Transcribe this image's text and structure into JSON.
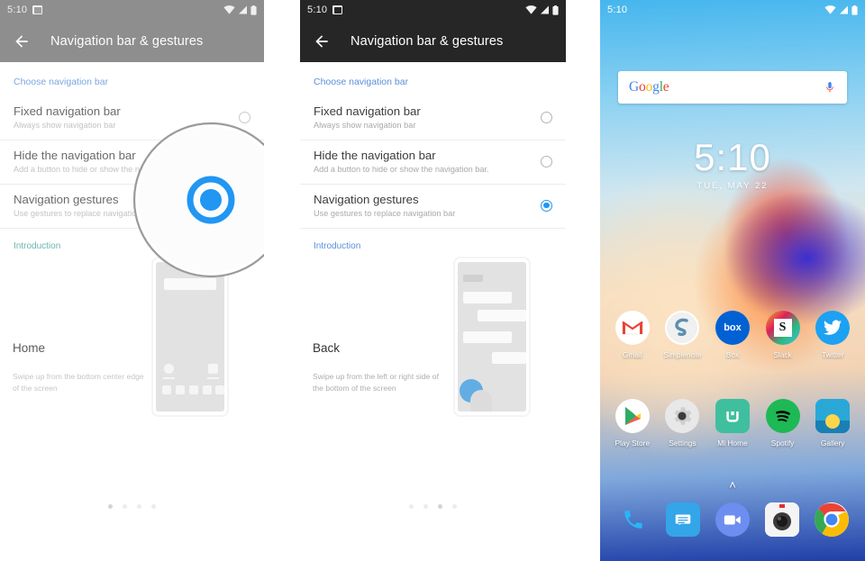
{
  "panel_one": {
    "status_bar": {
      "time": "5:10",
      "icons": [
        "screenshot-icon",
        "wifi-icon",
        "signal-icon",
        "battery-icon"
      ]
    },
    "app_bar": {
      "back_icon": "arrow-back-icon",
      "title": "Navigation bar & gestures"
    },
    "section_label": "Choose navigation bar",
    "options": [
      {
        "title": "Fixed navigation bar",
        "subtitle": "Always show navigation bar",
        "selected": false
      },
      {
        "title": "Hide the navigation bar",
        "subtitle": "Add a button to hide or show the navigation bar.",
        "selected": false
      },
      {
        "title": "Navigation gestures",
        "subtitle": "Use gestures to replace navigation bar",
        "selected": true
      }
    ],
    "intro_label": "Introduction",
    "illustration": {
      "title": "Home",
      "description": "Swipe up from the bottom center edge of the screen"
    },
    "pagination": {
      "count": 4,
      "active_index": 0
    },
    "magnifier": {
      "visible": true,
      "highlights": "navigation-gestures-radio",
      "accent_color": "#2196f3"
    }
  },
  "panel_two": {
    "status_bar": {
      "time": "5:10",
      "icons": [
        "screenshot-icon",
        "wifi-icon",
        "signal-icon",
        "battery-icon"
      ]
    },
    "app_bar": {
      "back_icon": "arrow-back-icon",
      "title": "Navigation bar & gestures"
    },
    "section_label": "Choose navigation bar",
    "options": [
      {
        "title": "Fixed navigation bar",
        "subtitle": "Always show navigation bar",
        "selected": false
      },
      {
        "title": "Hide the navigation bar",
        "subtitle": "Add a button to hide or show the navigation bar.",
        "selected": false
      },
      {
        "title": "Navigation gestures",
        "subtitle": "Use gestures to replace navigation bar",
        "selected": true
      }
    ],
    "intro_label": "Introduction",
    "illustration": {
      "title": "Back",
      "description": "Swipe up from the left or right side of the bottom of the screen"
    },
    "pagination": {
      "count": 4,
      "active_index": 2
    }
  },
  "panel_three": {
    "status_bar": {
      "time": "5:10",
      "icons": [
        "wifi-icon",
        "signal-icon",
        "battery-icon"
      ]
    },
    "search": {
      "logo": [
        "G",
        "o",
        "o",
        "g",
        "l",
        "e"
      ],
      "mic_icon": "microphone-icon",
      "placeholder": ""
    },
    "clock_widget": {
      "time": "5:10",
      "date": "TUE, MAY 22"
    },
    "app_rows": [
      [
        {
          "label": "Gmail",
          "icon": "gmail-icon"
        },
        {
          "label": "Simplenote",
          "icon": "simplenote-icon"
        },
        {
          "label": "Box",
          "icon": "box-icon"
        },
        {
          "label": "Slack",
          "icon": "slack-icon"
        },
        {
          "label": "Twitter",
          "icon": "twitter-icon"
        }
      ],
      [
        {
          "label": "Play Store",
          "icon": "play-store-icon"
        },
        {
          "label": "Settings",
          "icon": "settings-icon"
        },
        {
          "label": "Mi Home",
          "icon": "mi-home-icon"
        },
        {
          "label": "Spotify",
          "icon": "spotify-icon"
        },
        {
          "label": "Gallery",
          "icon": "gallery-icon"
        }
      ]
    ],
    "app_drawer_indicator": "˄",
    "dock": [
      {
        "label": "Phone",
        "icon": "phone-icon"
      },
      {
        "label": "Messages",
        "icon": "messages-icon"
      },
      {
        "label": "Duo",
        "icon": "duo-icon"
      },
      {
        "label": "Camera",
        "icon": "camera-icon"
      },
      {
        "label": "Chrome",
        "icon": "chrome-icon"
      }
    ]
  },
  "colors": {
    "accent_blue": "#2196f3",
    "panel_one_header": "#8e8e8e",
    "panel_two_header": "#262626",
    "link_blue": "#5b8fd8"
  }
}
